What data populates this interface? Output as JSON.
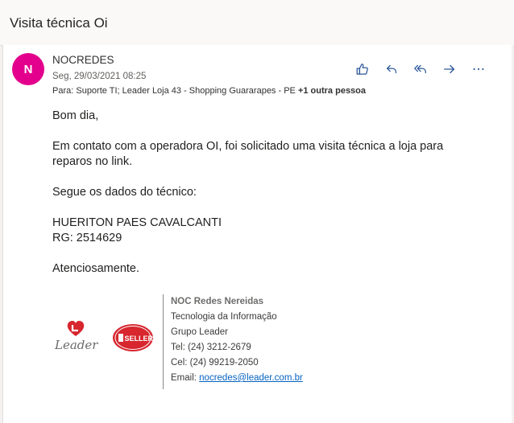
{
  "subject": "Visita técnica Oi",
  "message": {
    "avatar_initial": "N",
    "avatar_color": "#e3008c",
    "sender": "NOCREDES",
    "date": "Seg, 29/03/2021 08:25",
    "to_label": "Para:",
    "to_recipients": "Suporte TI; Leader Loja 43 - Shopping Guararapes - PE",
    "to_more": "+1 outra pessoa"
  },
  "actions": [
    "like-icon",
    "reply-icon",
    "reply-all-icon",
    "forward-icon",
    "more-icon"
  ],
  "body": {
    "greeting": "Bom dia,",
    "paragraph1": "Em contato com a operadora OI, foi solicitado uma visita técnica a loja para reparos no link.",
    "paragraph2": "Segue os dados do técnico:",
    "tech_name": "HUERITON PAES CAVALCANTI",
    "tech_rg": "RG: 2514629",
    "closing": "Atenciosamente."
  },
  "signature": {
    "title": "NOC Redes Nereidas",
    "line1": "Tecnologia da Informação",
    "line2": "Grupo Leader",
    "tel": "Tel: (24) 3212-2679",
    "cel": "Cel: (24) 99219-2050",
    "email_label": "Email: ",
    "email": "nocredes@leader.com.br",
    "logo_leader_text": "Leader",
    "logo_seller_text": "SELLER",
    "brand_red": "#d7262e"
  }
}
